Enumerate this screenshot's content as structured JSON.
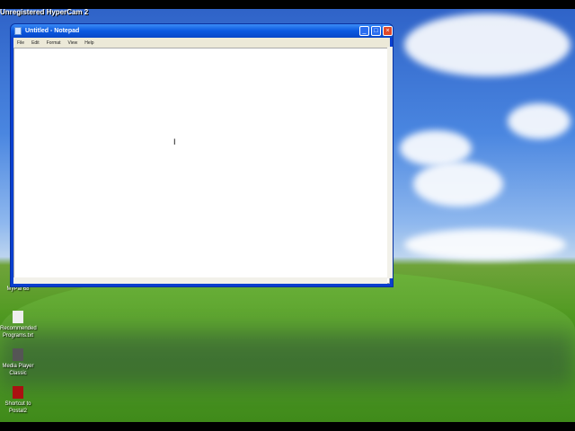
{
  "recorder_watermark": "Unregistered HyperCam 2",
  "window": {
    "title": "Untitled - Notepad",
    "menu": [
      "File",
      "Edit",
      "Format",
      "View",
      "Help"
    ],
    "content": ""
  },
  "desktop_icons": [
    {
      "label": "MyPal 68",
      "icon": "browser-icon"
    },
    {
      "label": "Recommended Programs.txt",
      "icon": "text-file-icon"
    },
    {
      "label": "Media Player Classic",
      "icon": "media-player-icon"
    },
    {
      "label": "Shortcut to Postal2",
      "icon": "game-shortcut-icon"
    }
  ],
  "colors": {
    "titlebar": "#0a58e0",
    "close": "#e04a2a",
    "menu_bg": "#ece9d8"
  }
}
